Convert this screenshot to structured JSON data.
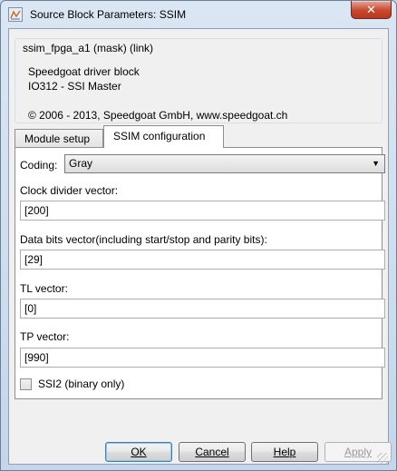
{
  "window": {
    "title": "Source Block Parameters: SSIM",
    "close_label": "✕"
  },
  "block": {
    "name": "ssim_fpga_a1 (mask) (link)",
    "description_line1": "Speedgoat driver block",
    "description_line2": "IO312 - SSI Master",
    "copyright": "© 2006 - 2013, Speedgoat GmbH, www.speedgoat.ch"
  },
  "tabs": [
    {
      "label": "Module setup",
      "active": false
    },
    {
      "label": "SSIM configuration",
      "active": true
    }
  ],
  "params": {
    "coding_label": "Coding:",
    "coding_value": "Gray",
    "clock_label": "Clock divider vector:",
    "clock_value": "[200]",
    "databits_label": "Data bits vector(including start/stop and parity bits):",
    "databits_value": "[29]",
    "tl_label": "TL vector:",
    "tl_value": "[0]",
    "tp_label": "TP vector:",
    "tp_value": "[990]",
    "ssi2_label": "SSI2 (binary only)",
    "ssi2_checked": false
  },
  "buttons": {
    "ok": "OK",
    "cancel": "Cancel",
    "help": "Help",
    "apply": "Apply"
  },
  "icons": {
    "app": "simulink-block-icon",
    "close": "close-icon",
    "dropdown": "chevron-down-icon"
  }
}
